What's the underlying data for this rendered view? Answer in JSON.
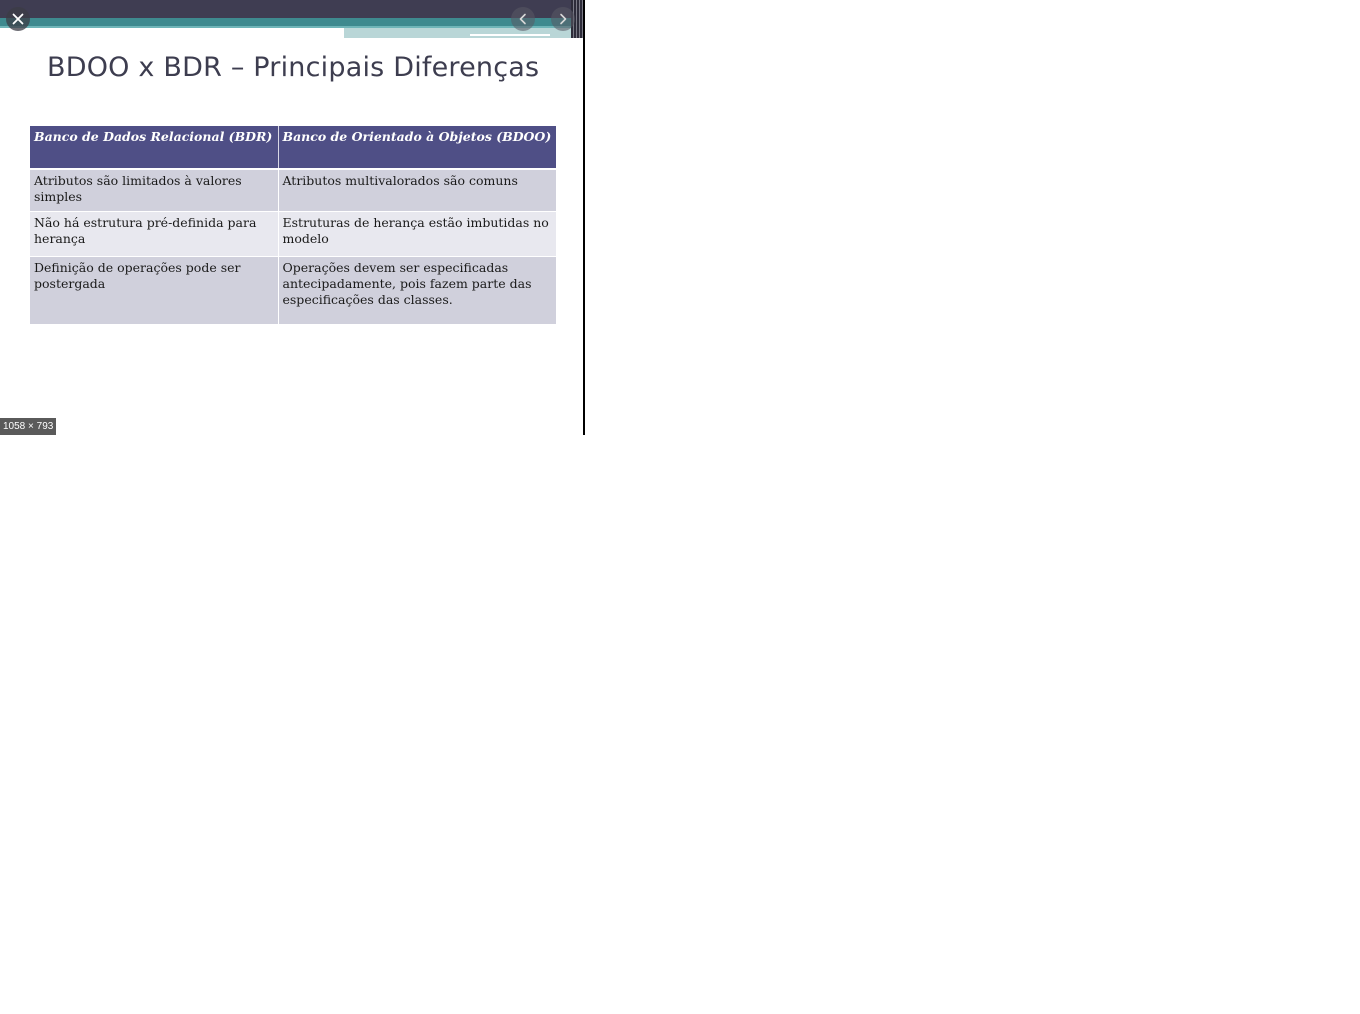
{
  "slide": {
    "title": "BDOO x BDR – Principais Diferenças",
    "table": {
      "headers": [
        "Banco de Dados Relacional (BDR)",
        "Banco de Orientado à Objetos (BDOO)"
      ],
      "rows": [
        [
          "Atributos são limitados à valores simples",
          "Atributos multivalorados são comuns"
        ],
        [
          "Não há estrutura pré-definida para herança",
          "Estruturas de herança estão imbutidas no modelo"
        ],
        [
          "Definição de operações pode ser postergada",
          "Operações devem ser especificadas antecipadamente, pois fazem parte das especificações das classes."
        ]
      ]
    }
  },
  "viewer": {
    "image_dimensions": "1058 × 793",
    "icons": {
      "close": "close-icon",
      "previous": "chevron-left-icon",
      "next": "chevron-right-icon"
    }
  },
  "colors": {
    "banner_dark": "#3f3d52",
    "banner_teal": "#3e8a8f",
    "table_header": "#4f4f86",
    "row_dark": "#d0d0dc",
    "row_light": "#e8e8ef",
    "title_text": "#3d3d4f"
  }
}
